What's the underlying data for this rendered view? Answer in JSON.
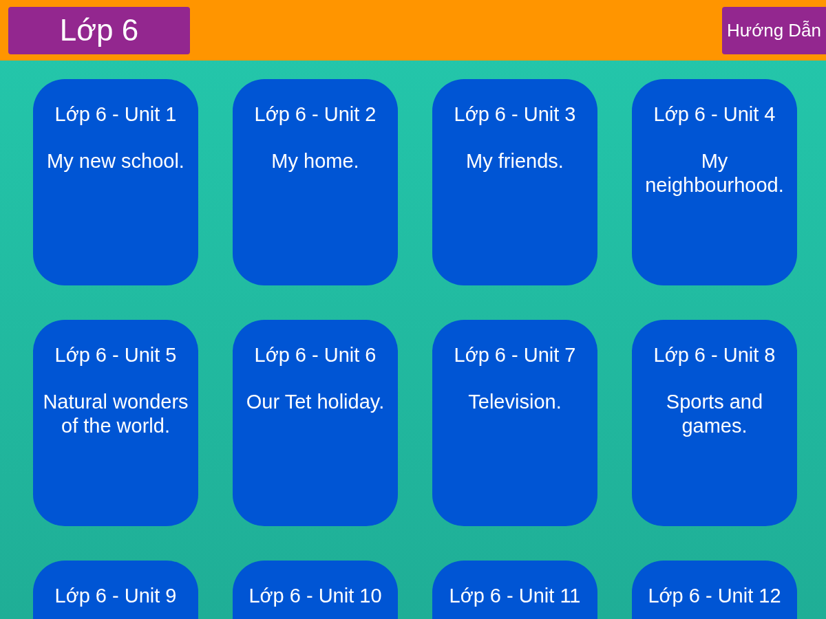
{
  "header": {
    "title": "Lớp 6",
    "guide_button": "Hướng Dẫn"
  },
  "units": [
    {
      "title": "Lớp 6 - Unit 1",
      "topic": "My new school."
    },
    {
      "title": "Lớp 6 - Unit 2",
      "topic": "My home."
    },
    {
      "title": "Lớp 6 - Unit 3",
      "topic": "My friends."
    },
    {
      "title": "Lớp 6 - Unit 4",
      "topic": "My neighbourhood."
    },
    {
      "title": "Lớp 6 - Unit 5",
      "topic": "Natural wonders of the world."
    },
    {
      "title": "Lớp 6 - Unit 6",
      "topic": "Our Tet holiday."
    },
    {
      "title": "Lớp 6 - Unit 7",
      "topic": "Television."
    },
    {
      "title": "Lớp 6 - Unit 8",
      "topic": "Sports and games."
    },
    {
      "title": "Lớp 6 - Unit 9"
    },
    {
      "title": "Lớp 6 - Unit 10"
    },
    {
      "title": "Lớp 6 - Unit 11"
    },
    {
      "title": "Lớp 6 - Unit 12"
    }
  ]
}
